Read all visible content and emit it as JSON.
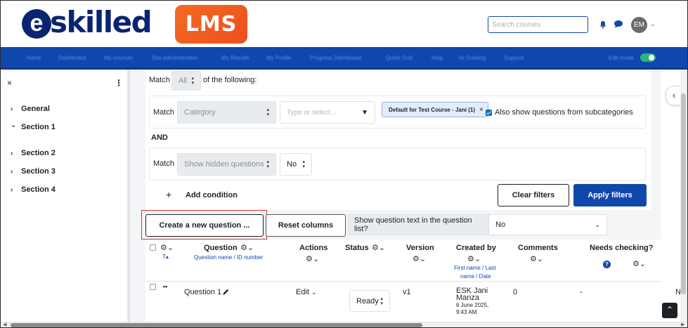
{
  "header": {
    "logo_e": "e",
    "logo_word": "skilled",
    "logo_badge": "LMS",
    "search_placeholder": "Search courses",
    "avatar_initials": "EM"
  },
  "navbar": {
    "items": [
      "Home",
      "Dashboard",
      "My courses",
      "Site administration",
      "My Results",
      "My Profile",
      "Progress Dashboard",
      "Quick Grid",
      "Help",
      "AI Grading",
      "Support",
      "Edit mode"
    ]
  },
  "sidebar": {
    "close": "×",
    "more": "⋮",
    "items": [
      {
        "label": "General",
        "chevron": "›"
      },
      {
        "label": "Section 1",
        "chevron": "⌄"
      },
      {
        "label": "Section 2",
        "chevron": "›"
      },
      {
        "label": "Section 3",
        "chevron": "›"
      },
      {
        "label": "Section 4",
        "chevron": "›"
      }
    ]
  },
  "filters": {
    "match_label": "Match",
    "match_value": "All",
    "following_text": "of the following:",
    "condition1": {
      "match_label": "Match",
      "type_value": "Category",
      "search_placeholder": "Type or select...",
      "selected_tag": "Default for Test Course - Jani (1)",
      "tag_remove": "×",
      "subcategories_label": "Also show questions from subcategories",
      "subcategories_checked": true
    },
    "and_label": "AND",
    "condition2": {
      "match_label": "Match",
      "type_value": "Show hidden questions",
      "value": "No"
    },
    "add_condition": "Add condition",
    "add_icon": "+",
    "clear_filters": "Clear filters",
    "apply_filters": "Apply filters"
  },
  "actions": {
    "create_question": "Create a new question ...",
    "reset_columns": "Reset columns",
    "show_text_label": "Show question text in the question list?",
    "show_text_value": "No"
  },
  "table": {
    "headers": {
      "type_sort": "T",
      "question": "Question",
      "question_sub": "Question name / ID number",
      "actions": "Actions",
      "status": "Status",
      "version": "Version",
      "created_by": "Created by",
      "created_sub_1": "First name / Last",
      "created_sub_2": "name / Date",
      "comments": "Comments",
      "needs_checking": "Needs checking?"
    },
    "rows": [
      {
        "name": "Question 1",
        "edit": "Edit",
        "status": "Ready",
        "version": "v1",
        "creator_1": "ESK Jani",
        "creator_2": "Manza",
        "date_1": "6 June 2025,",
        "date_2": "9:43 AM",
        "comments": "0",
        "needs_checking": "-",
        "overflow": "N"
      }
    ]
  },
  "colors": {
    "brand_blue": "#0f47ad",
    "logo_navy": "#0a2472",
    "lms_orange": "#f26b21",
    "highlight_red": "#d9302c"
  }
}
